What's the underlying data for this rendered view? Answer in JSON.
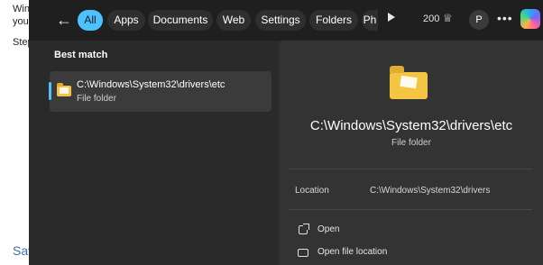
{
  "background_page": {
    "fragments": [
      "Win",
      "you",
      "Step",
      "Sav"
    ]
  },
  "topbar": {
    "back_icon": "back-arrow-icon",
    "filters": [
      "All",
      "Apps",
      "Documents",
      "Web",
      "Settings",
      "Folders",
      "Ph"
    ],
    "active_filter": "All",
    "points": "200",
    "rewards_icon": "trophy-icon",
    "avatar_letter": "P",
    "more_icon": "more-icon",
    "copilot_icon": "copilot-icon"
  },
  "results": {
    "section_title": "Best match",
    "best_match": {
      "title": "C:\\Windows\\System32\\drivers\\etc",
      "subtitle": "File folder",
      "icon": "folder-icon"
    }
  },
  "detail": {
    "title": "C:\\Windows\\System32\\drivers\\etc",
    "subtitle": "File folder",
    "location_label": "Location",
    "location_value": "C:\\Windows\\System32\\drivers",
    "actions": [
      {
        "label": "Open",
        "icon": "open-external-icon"
      },
      {
        "label": "Open file location",
        "icon": "folder-outline-icon"
      }
    ]
  },
  "colors": {
    "accent": "#4cc2ff",
    "window_bg": "#2a2a2a",
    "detail_bg": "#333333",
    "folder": "#f4c542"
  }
}
